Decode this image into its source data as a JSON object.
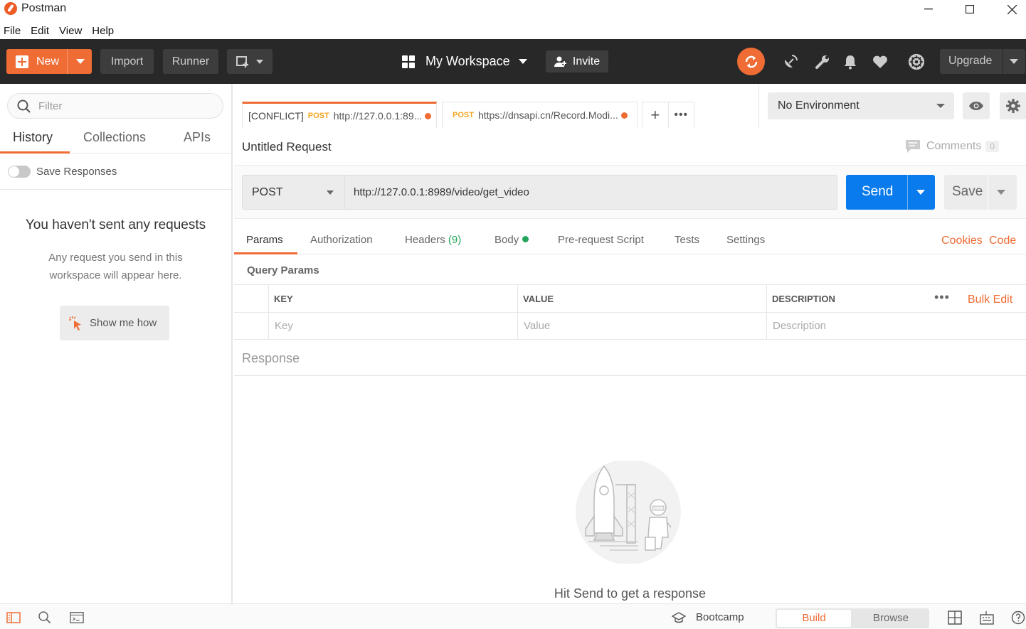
{
  "window": {
    "title": "Postman"
  },
  "menu": [
    "File",
    "Edit",
    "View",
    "Help"
  ],
  "header": {
    "new_label": "New",
    "import_label": "Import",
    "runner_label": "Runner",
    "workspace_label": "My Workspace",
    "invite_label": "Invite",
    "upgrade_label": "Upgrade"
  },
  "sidebar": {
    "filter_placeholder": "Filter",
    "tabs": [
      "History",
      "Collections",
      "APIs"
    ],
    "save_responses_label": "Save Responses",
    "empty_title": "You haven't sent any requests",
    "empty_desc": "Any request you send in this workspace will appear here.",
    "show_me_how": "Show me how"
  },
  "request_tabs": [
    {
      "prefix": "[CONFLICT]",
      "method": "POST",
      "url": "http://127.0.0.1:89...",
      "active": true
    },
    {
      "prefix": "",
      "method": "POST",
      "url": "https://dnsapi.cn/Record.Modi...",
      "active": false
    }
  ],
  "environment": {
    "selected": "No Environment"
  },
  "request": {
    "title": "Untitled Request",
    "comments_label": "Comments",
    "comments_count": "0",
    "method": "POST",
    "url": "http://127.0.0.1:8989/video/get_video",
    "send_label": "Send",
    "save_label": "Save"
  },
  "subtabs": {
    "params": "Params",
    "authorization": "Authorization",
    "headers": "Headers",
    "headers_count": "(9)",
    "body": "Body",
    "prerequest": "Pre-request Script",
    "tests": "Tests",
    "settings": "Settings",
    "cookies": "Cookies",
    "code": "Code"
  },
  "query_params": {
    "label": "Query Params",
    "columns": [
      "KEY",
      "VALUE",
      "DESCRIPTION"
    ],
    "placeholders": [
      "Key",
      "Value",
      "Description"
    ],
    "bulk_edit": "Bulk Edit"
  },
  "response": {
    "label": "Response",
    "hint": "Hit Send to get a response"
  },
  "statusbar": {
    "bootcamp": "Bootcamp",
    "build": "Build",
    "browse": "Browse"
  },
  "colors": {
    "accent": "#ef6c34",
    "send_blue": "#097bed",
    "header_bg": "#282828",
    "success_green": "#23a65a"
  }
}
